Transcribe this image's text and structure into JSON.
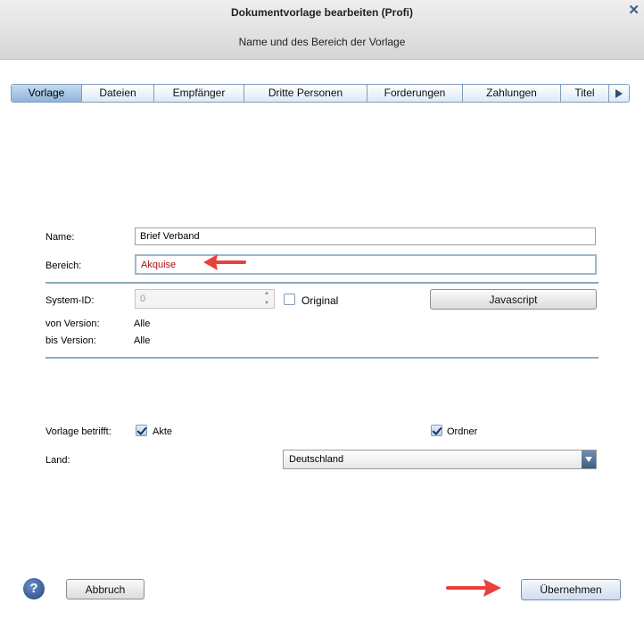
{
  "window": {
    "title": "Dokumentvorlage bearbeiten (Profi)",
    "subtitle": "Name und des Bereich der Vorlage",
    "close_icon": "close-icon"
  },
  "tabs": [
    {
      "label": "Vorlage",
      "active": true
    },
    {
      "label": "Dateien"
    },
    {
      "label": "Empfänger"
    },
    {
      "label": "Dritte Personen"
    },
    {
      "label": "Forderungen"
    },
    {
      "label": "Zahlungen"
    },
    {
      "label": "Titel"
    }
  ],
  "form": {
    "name_label": "Name:",
    "name_value": "Brief Verband",
    "bereich_label": "Bereich:",
    "bereich_value": "Akquise",
    "system_id_label": "System-ID:",
    "system_id_value": "0",
    "original_label": "Original",
    "javascript_button": "Javascript",
    "von_version_label": "von Version:",
    "von_version_value": "Alle",
    "bis_version_label": "bis Version:",
    "bis_version_value": "Alle",
    "vorlage_betrifft_label": "Vorlage betrifft:",
    "akte_label": "Akte",
    "ordner_label": "Ordner",
    "land_label": "Land:",
    "land_value": "Deutschland"
  },
  "footer": {
    "help_symbol": "?",
    "cancel_label": "Abbruch",
    "apply_label": "Übernehmen"
  },
  "colors": {
    "annotation_arrow": "#e8403a",
    "tab_active": "#8fb4d9",
    "bereich_text": "#b01010"
  }
}
